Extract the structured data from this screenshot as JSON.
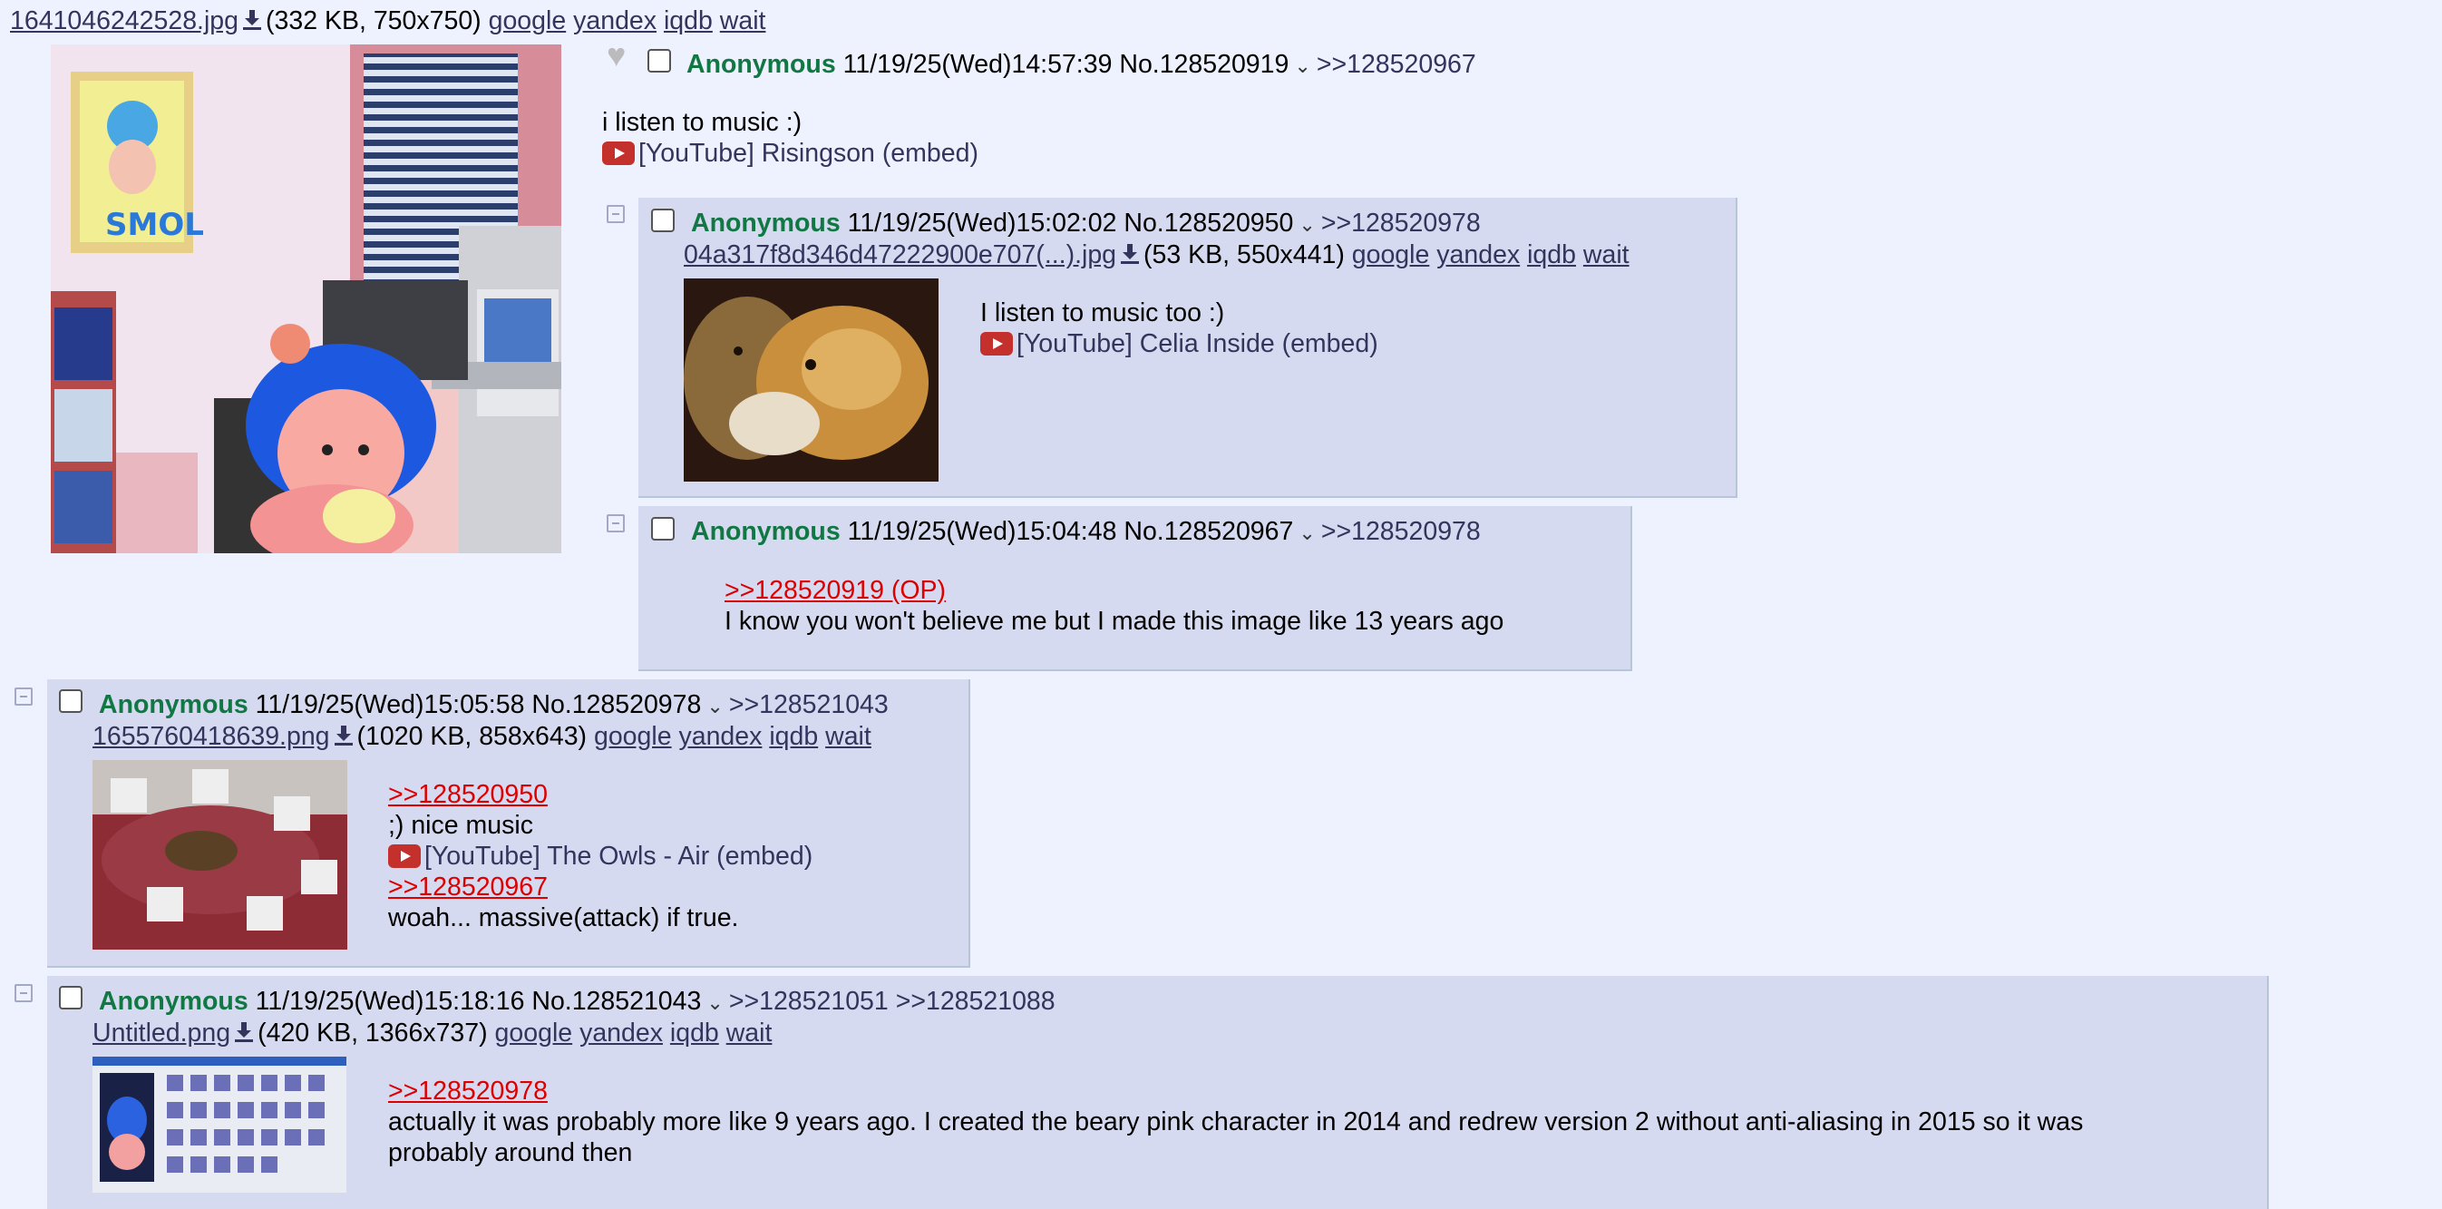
{
  "op": {
    "file_name": "1641046242528.jpg",
    "file_info": "(332 KB, 750x750)",
    "search_links": [
      "google",
      "yandex",
      "iqdb",
      "wait"
    ],
    "name": "Anonymous",
    "datetime": "11/19/25(Wed)14:57:39",
    "post_no": "No.128520919",
    "backlinks": [
      ">>128520967"
    ],
    "comment": "i listen to music :)",
    "embed": "[YouTube] Risingson (embed)"
  },
  "replies": [
    {
      "name": "Anonymous",
      "datetime": "11/19/25(Wed)15:02:02",
      "post_no": "No.128520950",
      "backlinks": [
        ">>128520978"
      ],
      "file_name": "04a317f8d346d47222900e707(...).jpg",
      "file_info": "(53 KB, 550x441)",
      "lines": [
        "I listen to music too :)"
      ],
      "embed": "[YouTube] Celia Inside (embed)"
    },
    {
      "name": "Anonymous",
      "datetime": "11/19/25(Wed)15:04:48",
      "post_no": "No.128520967",
      "backlinks": [
        ">>128520978"
      ],
      "quote": ">>128520919 (OP)",
      "lines": [
        "I know you won't believe me but I made this image like 13 years ago"
      ]
    },
    {
      "name": "Anonymous",
      "datetime": "11/19/25(Wed)15:05:58",
      "post_no": "No.128520978",
      "backlinks": [
        ">>128521043"
      ],
      "file_name": "1655760418639.png",
      "file_info": "(1020 KB, 858x643)",
      "quote": ">>128520950",
      "lines": [
        ";) nice music",
        "woah... massive(attack) if true."
      ],
      "embed": "[YouTube] The Owls - Air (embed)",
      "quote2": ">>128520967"
    },
    {
      "name": "Anonymous",
      "datetime": "11/19/25(Wed)15:18:16",
      "post_no": "No.128521043",
      "backlinks": [
        ">>128521051",
        ">>128521088"
      ],
      "file_name": "Untitled.png",
      "file_info": "(420 KB, 1366x737)",
      "quote": ">>128520978",
      "lines": [
        "actually it was probably more like 9 years ago. I created the beary pink character in 2014 and redrew version 2 without anti-aliasing in 2015 so it was",
        "probably around then"
      ]
    }
  ],
  "colors": {
    "background": "#eef2ff",
    "reply_background": "#d6daf0",
    "name": "#117743",
    "quote_link": "#dd0000",
    "link": "#34345c"
  },
  "icons": [
    "download-icon",
    "chevron-down-icon",
    "heart-icon",
    "youtube-icon",
    "minus-toggle-icon"
  ]
}
